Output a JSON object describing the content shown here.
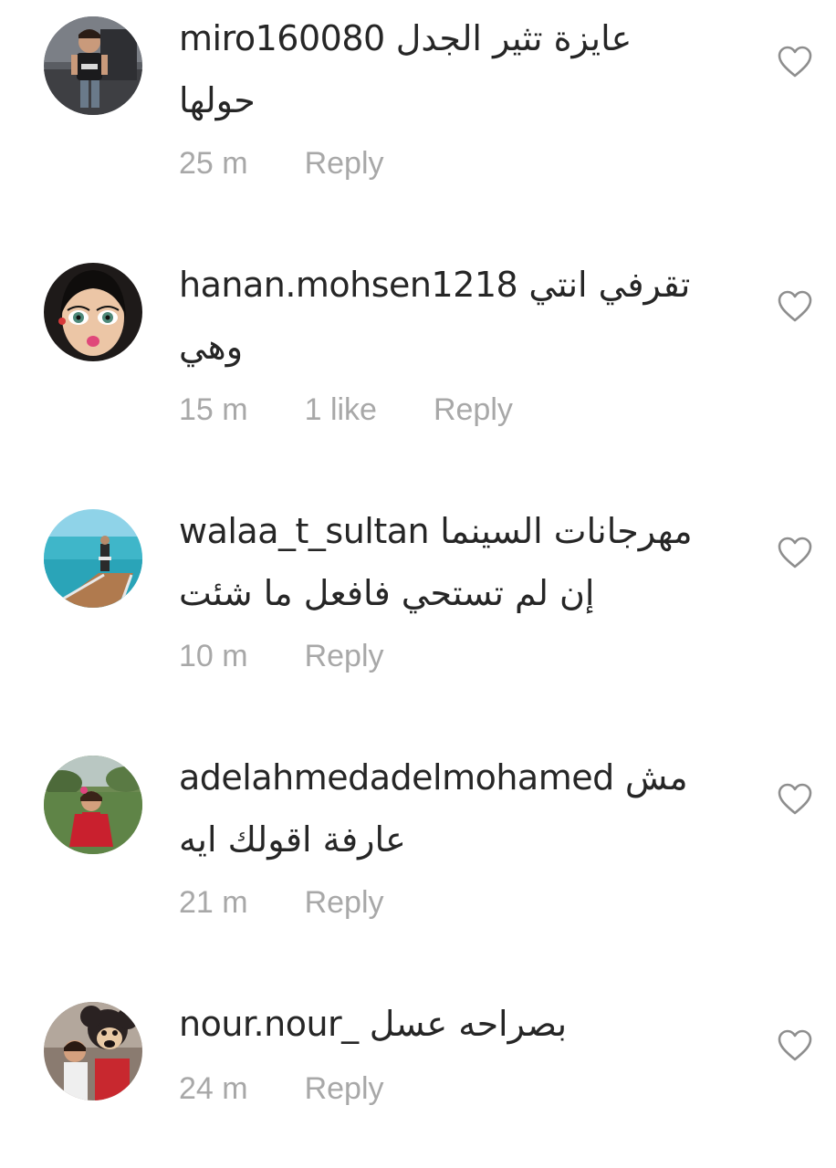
{
  "comments": [
    {
      "username": "miro160080",
      "text_line1": "عايزة تثير الجدل",
      "text_line2": "حولها",
      "time": "25 m",
      "likes": "",
      "reply": "Reply"
    },
    {
      "username": "hanan.mohsen1218",
      "text_line1": "تقرفي انتي",
      "text_line2": "وهي",
      "time": "15 m",
      "likes": "1 like",
      "reply": "Reply"
    },
    {
      "username": "walaa_t_sultan",
      "text_line1": "مهرجانات السينما",
      "text_line2": "إن لم تستحي  فافعل ما شئت",
      "time": "10 m",
      "likes": "",
      "reply": "Reply"
    },
    {
      "username": "adelahmedadelmohamed",
      "text_line1": "مش",
      "text_line2": "عارفة اقولك ايه",
      "time": "21 m",
      "likes": "",
      "reply": "Reply"
    },
    {
      "username": "nour.nour_",
      "text_line1": "بصراحه عسل",
      "text_line2": "",
      "time": "24 m",
      "likes": "",
      "reply": "Reply"
    }
  ],
  "icons": {
    "like": "heart-outline-icon"
  },
  "colors": {
    "text": "#262626",
    "meta": "#a8a8a8",
    "heart": "#8e8e8e"
  }
}
